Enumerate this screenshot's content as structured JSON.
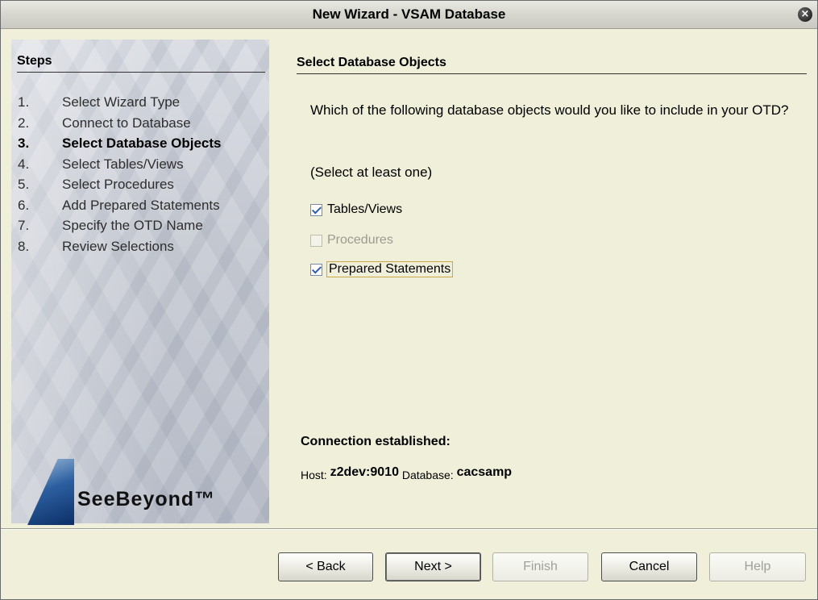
{
  "window": {
    "title": "New Wizard - VSAM Database",
    "close_glyph": "×"
  },
  "steps": {
    "heading": "Steps",
    "current_index": 2,
    "items": [
      {
        "num": "1.",
        "label": "Select Wizard Type"
      },
      {
        "num": "2.",
        "label": "Connect to Database"
      },
      {
        "num": "3.",
        "label": "Select Database Objects"
      },
      {
        "num": "4.",
        "label": "Select Tables/Views"
      },
      {
        "num": "5.",
        "label": "Select Procedures"
      },
      {
        "num": "6.",
        "label": "Add Prepared Statements"
      },
      {
        "num": "7.",
        "label": "Specify the OTD Name"
      },
      {
        "num": "8.",
        "label": "Review Selections"
      }
    ]
  },
  "logo": {
    "text": "SeeBeyond™"
  },
  "main": {
    "title": "Select Database Objects",
    "question": "Which of the following database objects would you like to include in your OTD?",
    "hint": "(Select at least one)",
    "options": [
      {
        "label": "Tables/Views",
        "checked": true,
        "enabled": true
      },
      {
        "label": "Procedures",
        "checked": false,
        "enabled": false
      },
      {
        "label": "Prepared Statements",
        "checked": true,
        "enabled": true
      }
    ]
  },
  "connection": {
    "title": "Connection established:",
    "host_label": "Host:",
    "host_value": "z2dev:9010",
    "db_label": "Database:",
    "db_value": "cacsamp"
  },
  "buttons": {
    "back": "< Back",
    "next": "Next >",
    "finish": "Finish",
    "cancel": "Cancel",
    "help": "Help"
  },
  "colors": {
    "background": "#f0efda",
    "accent": "#2f5fa8"
  }
}
